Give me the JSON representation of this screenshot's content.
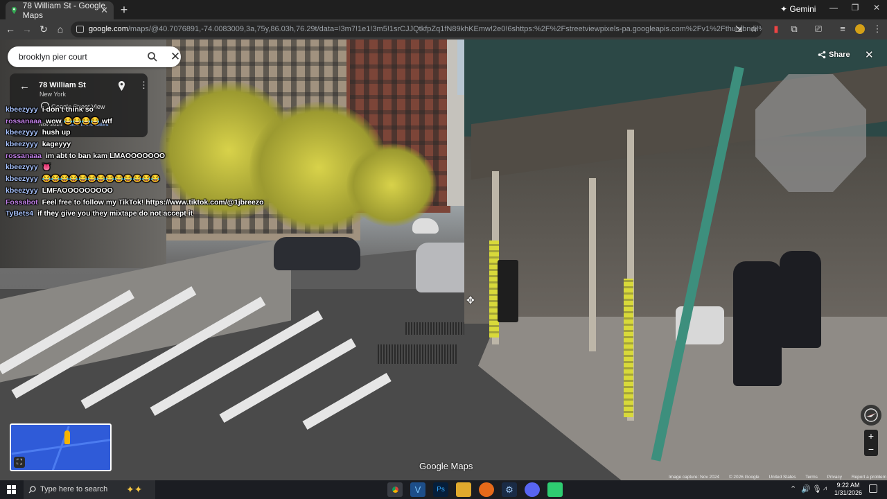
{
  "browser": {
    "tab_title": "78 William St - Google Maps",
    "new_tab": "+",
    "gemini_label": "Gemini",
    "url_host": "google.com",
    "url_path": "/maps/@40.7076891,-74.0083009,3a,75y,86.03h,76.29t/data=!3m7!1e1!3m5!1srCJJQtkfpZq1fN89khKEmw!2e0!6shttps:%2F%2Fstreetviewpixels-pa.googleapis.com%2Fv1%2Fthumbnail%3Fcb_client%3Dmaps_sv.ta..."
  },
  "search": {
    "value": "brooklyn pier court"
  },
  "location_card": {
    "title": "78 William St",
    "subtitle": "New York",
    "source": "Google Street View",
    "date": "Nov 2024",
    "more_dates": "See more dates"
  },
  "chat": [
    {
      "user": "kbeezyyy",
      "text": "i don't think so",
      "color": "#a9c4ff"
    },
    {
      "user": "rossanaaa",
      "text": "wow 😂😂😂😂 wtf",
      "color": "#c07fe6"
    },
    {
      "user": "kbeezyyy",
      "text": "hush up",
      "color": "#a9c4ff"
    },
    {
      "user": "kbeezyyy",
      "text": "kageyyy",
      "color": "#a9c4ff"
    },
    {
      "user": "rossanaaa",
      "text": "im abt to ban kam LMAOOOOOOO",
      "color": "#c07fe6"
    },
    {
      "user": "kbeezyyy",
      "text": "👅",
      "color": "#a9c4ff"
    },
    {
      "user": "kbeezyyy",
      "text": "😂😂😂😂😂😂😂😂😂😂😂😂😂",
      "color": "#a9c4ff"
    },
    {
      "user": "kbeezyyy",
      "text": "LMFAOOOOOOOOO",
      "color": "#a9c4ff"
    },
    {
      "user": "Fossabot",
      "text": "Feel free to follow my TikTok! https://www.tiktok.com/@1jbreezo",
      "color": "#c07fe6"
    },
    {
      "user": "TyBets4",
      "text": "if they give you they mixtape do not accept it",
      "color": "#a9c4ff"
    }
  ],
  "controls": {
    "share_label": "Share",
    "close_glyph": "✕",
    "zoom_in": "+",
    "zoom_out": "−",
    "minimap_expand": "⛶"
  },
  "branding": {
    "logo_text": "Google Maps"
  },
  "footer": {
    "image_capture": "Image capture: Nov 2024",
    "copyright": "© 2026 Google",
    "country": "United States",
    "terms": "Terms",
    "privacy": "Privacy",
    "report": "Report a problem"
  },
  "taskbar": {
    "search_placeholder": "Type here to search",
    "time": "9:22 AM",
    "date": "1/31/2026"
  },
  "colors": {
    "maps_blue": "#2f5bd8",
    "pegman_yellow": "#f6b400"
  }
}
